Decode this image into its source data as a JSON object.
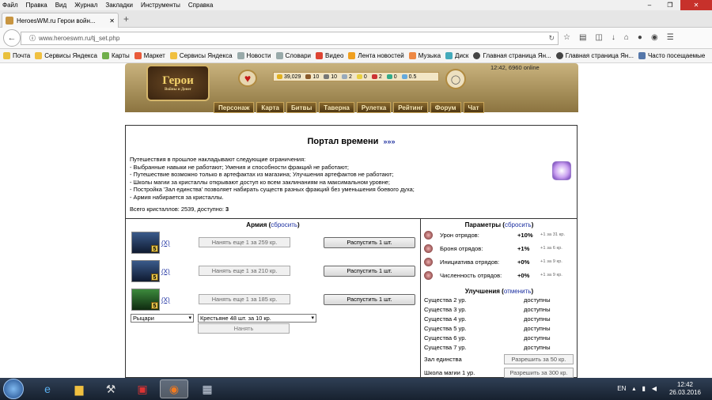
{
  "browser": {
    "menu": [
      "Файл",
      "Правка",
      "Вид",
      "Журнал",
      "Закладки",
      "Инструменты",
      "Справка"
    ],
    "tab_title": "HeroesWM.ru Герои войн...",
    "url": "www.heroeswm.ru/tj_set.php",
    "bookmarks": [
      "Почта",
      "Сервисы Яндекса",
      "Карты",
      "Маркет",
      "Сервисы Яндекса",
      "Новости",
      "Словари",
      "Видео",
      "Лента новостей",
      "Музыка",
      "Диск",
      "Главная страница Ян...",
      "Главная страница Ян...",
      "Часто посещаемые"
    ]
  },
  "game": {
    "logo": "Герои",
    "logo_sub": "Войны и Денег",
    "online": "12:42, 6960 online",
    "resources": [
      "39,029",
      "10",
      "10",
      "2",
      "0",
      "2",
      "0",
      "0.5"
    ],
    "nav": [
      "Персонаж",
      "Карта",
      "Битвы",
      "Таверна",
      "Рулетка",
      "Рейтинг",
      "Форум",
      "Чат"
    ]
  },
  "portal": {
    "title": "Портал времени",
    "title_link": "»»»",
    "restrictions": [
      "Путешествия в прошлое накладывают следующие ограничения:",
      "- Выбранные навыки не работают; Умения и способности фракций не работают;",
      "- Путешествие возможно только в артефактах из магазина; Улучшения артефактов не работают;",
      "- Школы магии за кристаллы открывают доступ ко всем заклинаниям на максимальном уровне;",
      "- Постройка 'Зал единства' позволяет набирать существ разных фракций без уменьшения боевого духа;",
      "- Армия набирается за кристаллы."
    ],
    "crystals_text": "Всего кристаллов: 2539, доступно: ",
    "crystals_available": "3"
  },
  "army": {
    "title": "Армия",
    "reset": "сбросить",
    "units": [
      {
        "level": "5",
        "remove": "(X)",
        "hire": "Нанять еще 1 за 259 кр.",
        "disband": "Распустить 1 шт."
      },
      {
        "level": "5",
        "remove": "(X)",
        "hire": "Нанять еще 1 за 210 кр.",
        "disband": "Распустить 1 шт."
      },
      {
        "level": "5",
        "remove": "(X)",
        "hire": "Нанять еще 1 за 185 кр.",
        "disband": "Распустить 1 шт."
      }
    ],
    "faction_select": "Рыцари",
    "creature_select": "Крестьяне 48 шт. за 10 кр.",
    "buy": "Нанять"
  },
  "params": {
    "title": "Параметры",
    "reset": "сбросить",
    "items": [
      {
        "label": "Урон отрядов:",
        "value": "+10%",
        "step": "+1 за 31 кр."
      },
      {
        "label": "Броня отрядов:",
        "value": "+1%",
        "step": "+1 за 6 кр."
      },
      {
        "label": "Инициатива отрядов:",
        "value": "+0%",
        "step": "+1 за 9 кр."
      },
      {
        "label": "Численность отрядов:",
        "value": "+0%",
        "step": "+1 за 9 кр."
      }
    ]
  },
  "upgrades": {
    "title": "Улучшения",
    "cancel": "отменить",
    "rows": [
      {
        "label": "Существа 2 ур.",
        "value": "доступны"
      },
      {
        "label": "Существа 3 ур.",
        "value": "доступны"
      },
      {
        "label": "Существа 4 ур.",
        "value": "доступны"
      },
      {
        "label": "Существа 5 ур.",
        "value": "доступны"
      },
      {
        "label": "Существа 6 ур.",
        "value": "доступны"
      },
      {
        "label": "Существа 7 ур.",
        "value": "доступны"
      }
    ],
    "hall_label": "Зал единства",
    "hall_btn": "Разрешить за 50 кр.",
    "school_label": "Школа магии 1 ур.",
    "school_btn": "Разрешить за 300 кр."
  },
  "taskbar": {
    "lang": "EN",
    "time": "12:42",
    "date": "26.03.2016"
  }
}
